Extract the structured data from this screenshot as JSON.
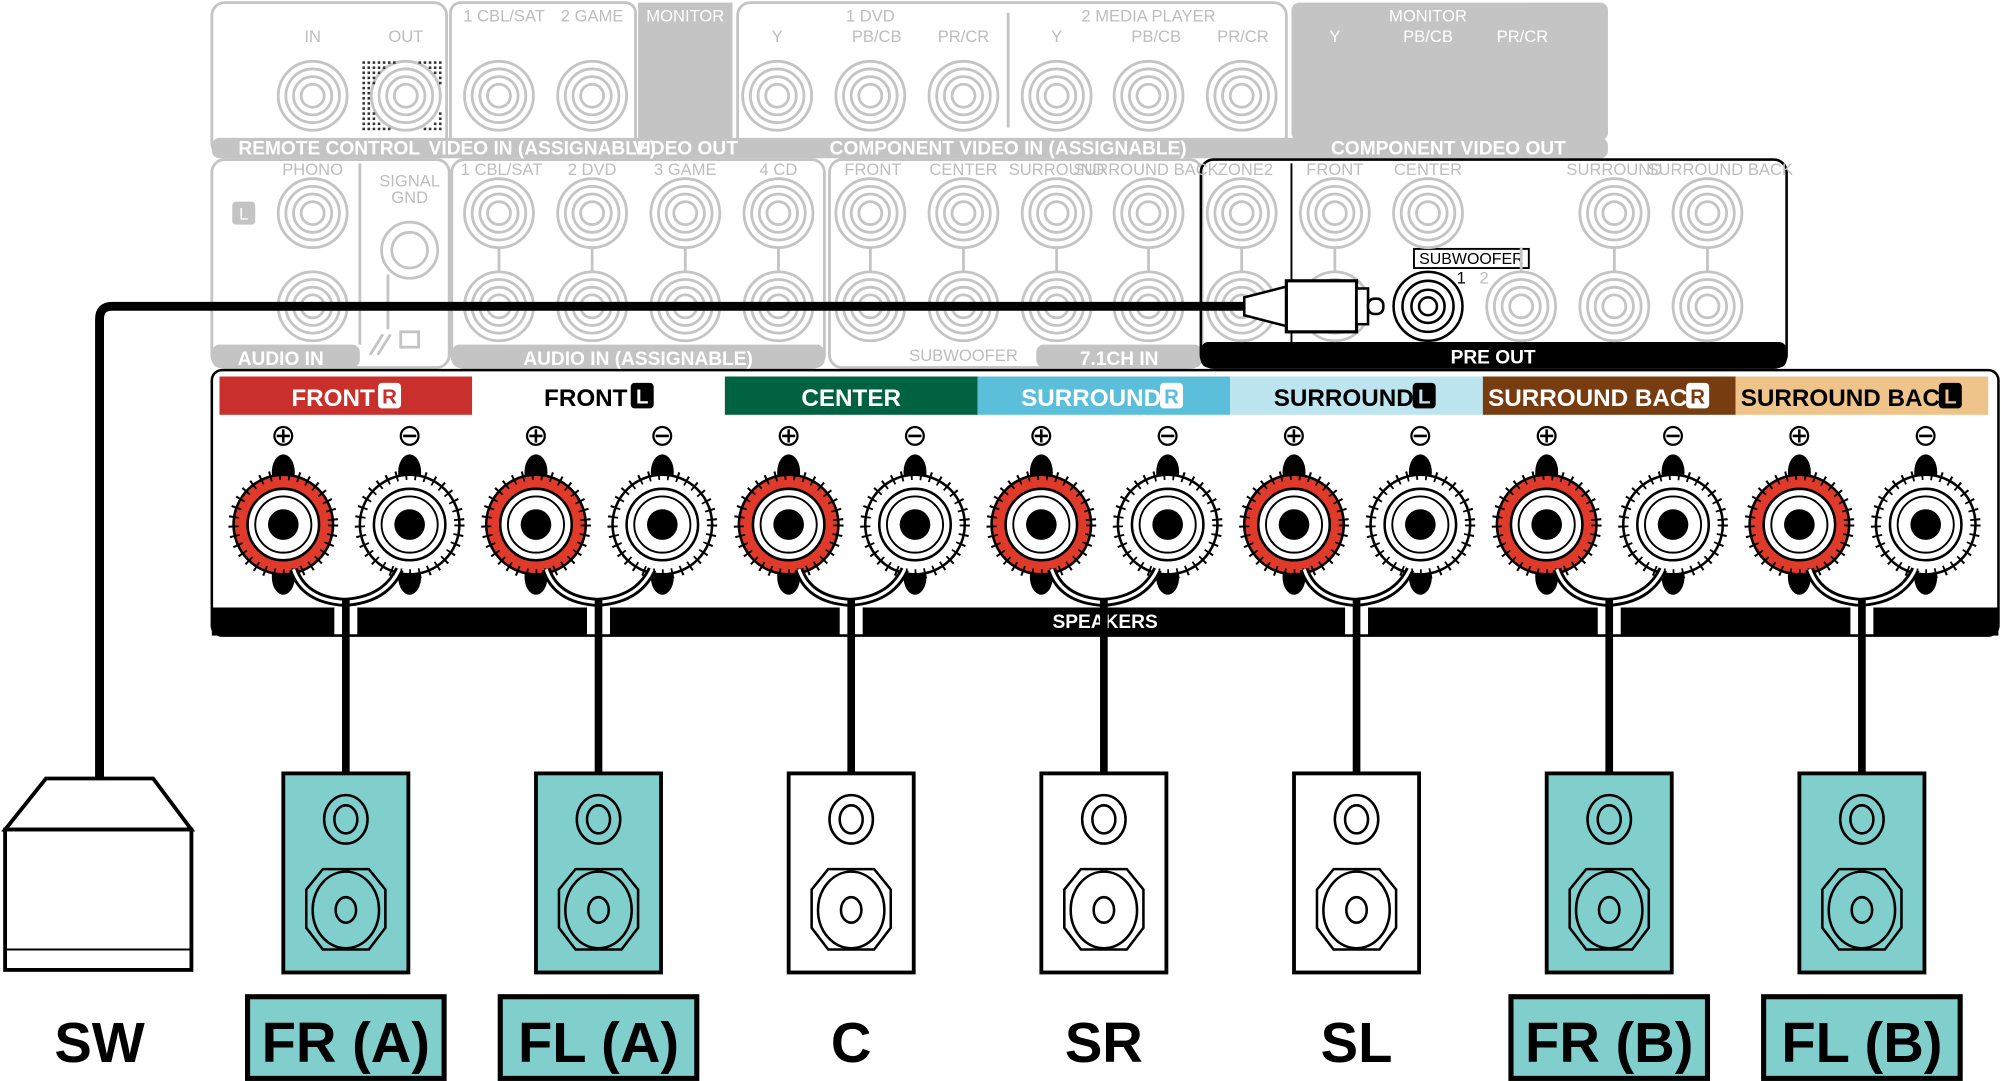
{
  "panel": {
    "labels": [
      "IN",
      "OUT",
      "1 CBL/SAT",
      "2 GAME",
      "1 DVD",
      "2 MEDIA PLAYER",
      "Y",
      "PB/CB",
      "PR/CR",
      "Y",
      "PB/CB",
      "PR/CR",
      "PHONO",
      "SIGNAL",
      "GND",
      "1 CBL/SAT",
      "2 DVD",
      "3 GAME",
      "4 CD",
      "FRONT",
      "CENTER",
      "SURROUND",
      "SURROUND BACK",
      "ZONE2",
      "FRONT",
      "CENTER",
      "SURROUND",
      "SURROUND BACK",
      "2"
    ],
    "white_labels": [
      "MONITOR",
      "MONITOR",
      "Y",
      "PB/CB",
      "PR/CR"
    ],
    "band_labels": [
      "REMOTE CONTROL",
      "VIDEO IN (ASSIGNABLE)",
      "VIDEO OUT",
      "COMPONENT VIDEO IN (ASSIGNABLE)",
      "COMPONENT VIDEO OUT",
      "AUDIO IN",
      "AUDIO IN (ASSIGNABLE)",
      "7.1CH IN",
      "SUBWOOFER"
    ],
    "l_badge": "L",
    "subwoofer_tag": "SUBWOOFER",
    "subwoofer_port_1": "1",
    "pre_out": "PRE OUT",
    "speakers_label": "SPEAKERS",
    "plus_symbol": "⊕",
    "minus_symbol": "⊖"
  },
  "channels": [
    {
      "name": "FRONT",
      "badge": "R",
      "bg": "#c9302c",
      "fg": "#ffffff"
    },
    {
      "name": "FRONT",
      "badge": "L",
      "bg": "#ffffff",
      "fg": "#000000"
    },
    {
      "name": "CENTER",
      "badge": "",
      "bg": "#006241",
      "fg": "#ffffff"
    },
    {
      "name": "SURROUND",
      "badge": "R",
      "bg": "#5bbfdc",
      "fg": "#ffffff"
    },
    {
      "name": "SURROUND",
      "badge": "L",
      "bg": "#bde5f0",
      "fg": "#000000"
    },
    {
      "name": "SURROUND BACK",
      "badge": "R",
      "bg": "#773c10",
      "fg": "#ffffff"
    },
    {
      "name": "SURROUND BACK",
      "badge": "L",
      "bg": "#efc48b",
      "fg": "#000000"
    }
  ],
  "speakers": [
    {
      "label": "FR (A)",
      "color": "#80cfcd",
      "boxed": true
    },
    {
      "label": "FL (A)",
      "color": "#80cfcd",
      "boxed": true
    },
    {
      "label": "C",
      "color": "#ffffff",
      "boxed": false
    },
    {
      "label": "SR",
      "color": "#ffffff",
      "boxed": false
    },
    {
      "label": "SL",
      "color": "#ffffff",
      "boxed": false
    },
    {
      "label": "FR (B)",
      "color": "#80cfcd",
      "boxed": true
    },
    {
      "label": "FL (B)",
      "color": "#80cfcd",
      "boxed": true
    }
  ],
  "subwoofer": {
    "label": "SW"
  },
  "colors": {
    "panel_grey": "#c4c4c4",
    "terminal_red": "#e03a2a",
    "teal": "#80cfcd"
  }
}
